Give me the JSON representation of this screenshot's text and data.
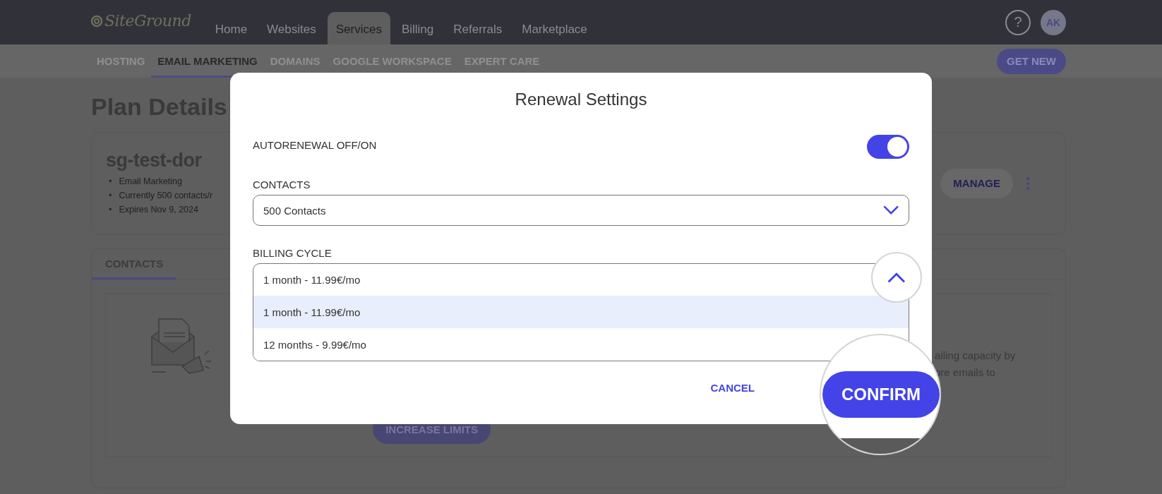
{
  "header": {
    "logo": "SiteGround",
    "nav": [
      {
        "label": "Home",
        "selected": false
      },
      {
        "label": "Websites",
        "selected": false
      },
      {
        "label": "Services",
        "selected": true
      },
      {
        "label": "Billing",
        "selected": false
      },
      {
        "label": "Referrals",
        "selected": false
      },
      {
        "label": "Marketplace",
        "selected": false
      }
    ],
    "help": "?",
    "avatar": "AK"
  },
  "subnav": {
    "items": [
      {
        "label": "HOSTING",
        "selected": false
      },
      {
        "label": "EMAIL MARKETING",
        "selected": true
      },
      {
        "label": "DOMAINS",
        "selected": false
      },
      {
        "label": "GOOGLE WORKSPACE",
        "selected": false
      },
      {
        "label": "EXPERT CARE",
        "selected": false
      }
    ],
    "button": "GET NEW"
  },
  "page": {
    "title": "Plan Details",
    "plan_card": {
      "name": "sg-test-dor",
      "marker": "•",
      "details": [
        "Email Marketing",
        "Currently 500 contacts/r",
        "Expires Nov 9, 2024"
      ],
      "button": "MANAGE"
    },
    "tabs": [
      {
        "label": "CONTACTS",
        "selected": true
      }
    ],
    "promo": {
      "text_lines": [
        "ailing capacity by",
        "ore emails to"
      ],
      "button": "INCREASE LIMITS"
    }
  },
  "modal": {
    "title": "Renewal Settings",
    "autorenewal": {
      "label": "AUTORENEWAL OFF/ON",
      "on": true
    },
    "contacts": {
      "label": "CONTACTS",
      "value": "500 Contacts"
    },
    "billing_cycle": {
      "label": "BILLING CYCLE",
      "value": "1 month - 11.99€/mo",
      "expanded": true,
      "options": [
        {
          "label": "1 month - 11.99€/mo",
          "selected": true
        },
        {
          "label": "12 months - 9.99€/mo",
          "selected": false
        }
      ]
    },
    "cancel": "CANCEL",
    "confirm": "CONFIRM"
  }
}
